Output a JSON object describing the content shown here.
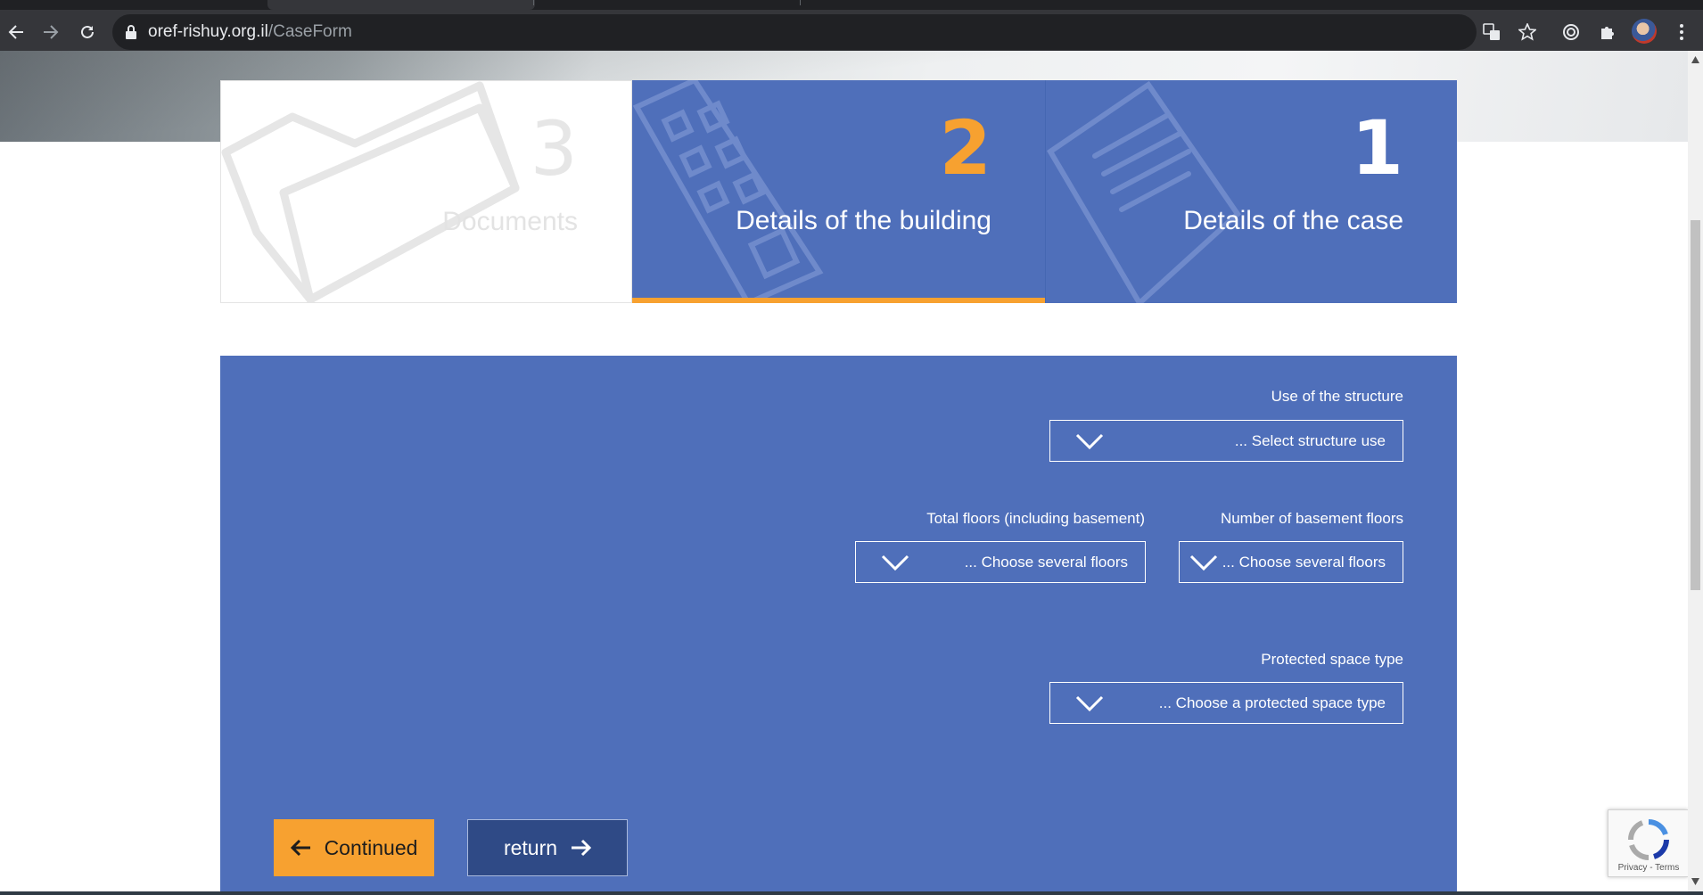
{
  "browser": {
    "url_host": "oref-rishuy.org.il",
    "url_path": "/CaseForm"
  },
  "steps": [
    {
      "number": "3",
      "label": "Documents",
      "state": "upcoming",
      "icon": "folder-icon"
    },
    {
      "number": "2",
      "label": "Details of the building",
      "state": "active",
      "icon": "building-icon"
    },
    {
      "number": "1",
      "label": "Details of the case",
      "state": "completed",
      "icon": "document-icon"
    }
  ],
  "form": {
    "structure_use": {
      "label": "Use of the structure",
      "placeholder": "... Select structure use"
    },
    "total_floors": {
      "label": "Total floors (including basement)",
      "placeholder": "... Choose several floors"
    },
    "basement_floors": {
      "label": "Number of basement floors",
      "placeholder": "... Choose several floors"
    },
    "protected_space": {
      "label": "Protected space type",
      "placeholder": "... Choose a protected space type"
    }
  },
  "buttons": {
    "continue_label": "Continued",
    "return_label": "return"
  },
  "recaptcha": {
    "links": "Privacy - Terms"
  },
  "colors": {
    "panel_blue": "#4f6fba",
    "accent_orange": "#f7a130",
    "return_navy": "#2f4a86"
  }
}
